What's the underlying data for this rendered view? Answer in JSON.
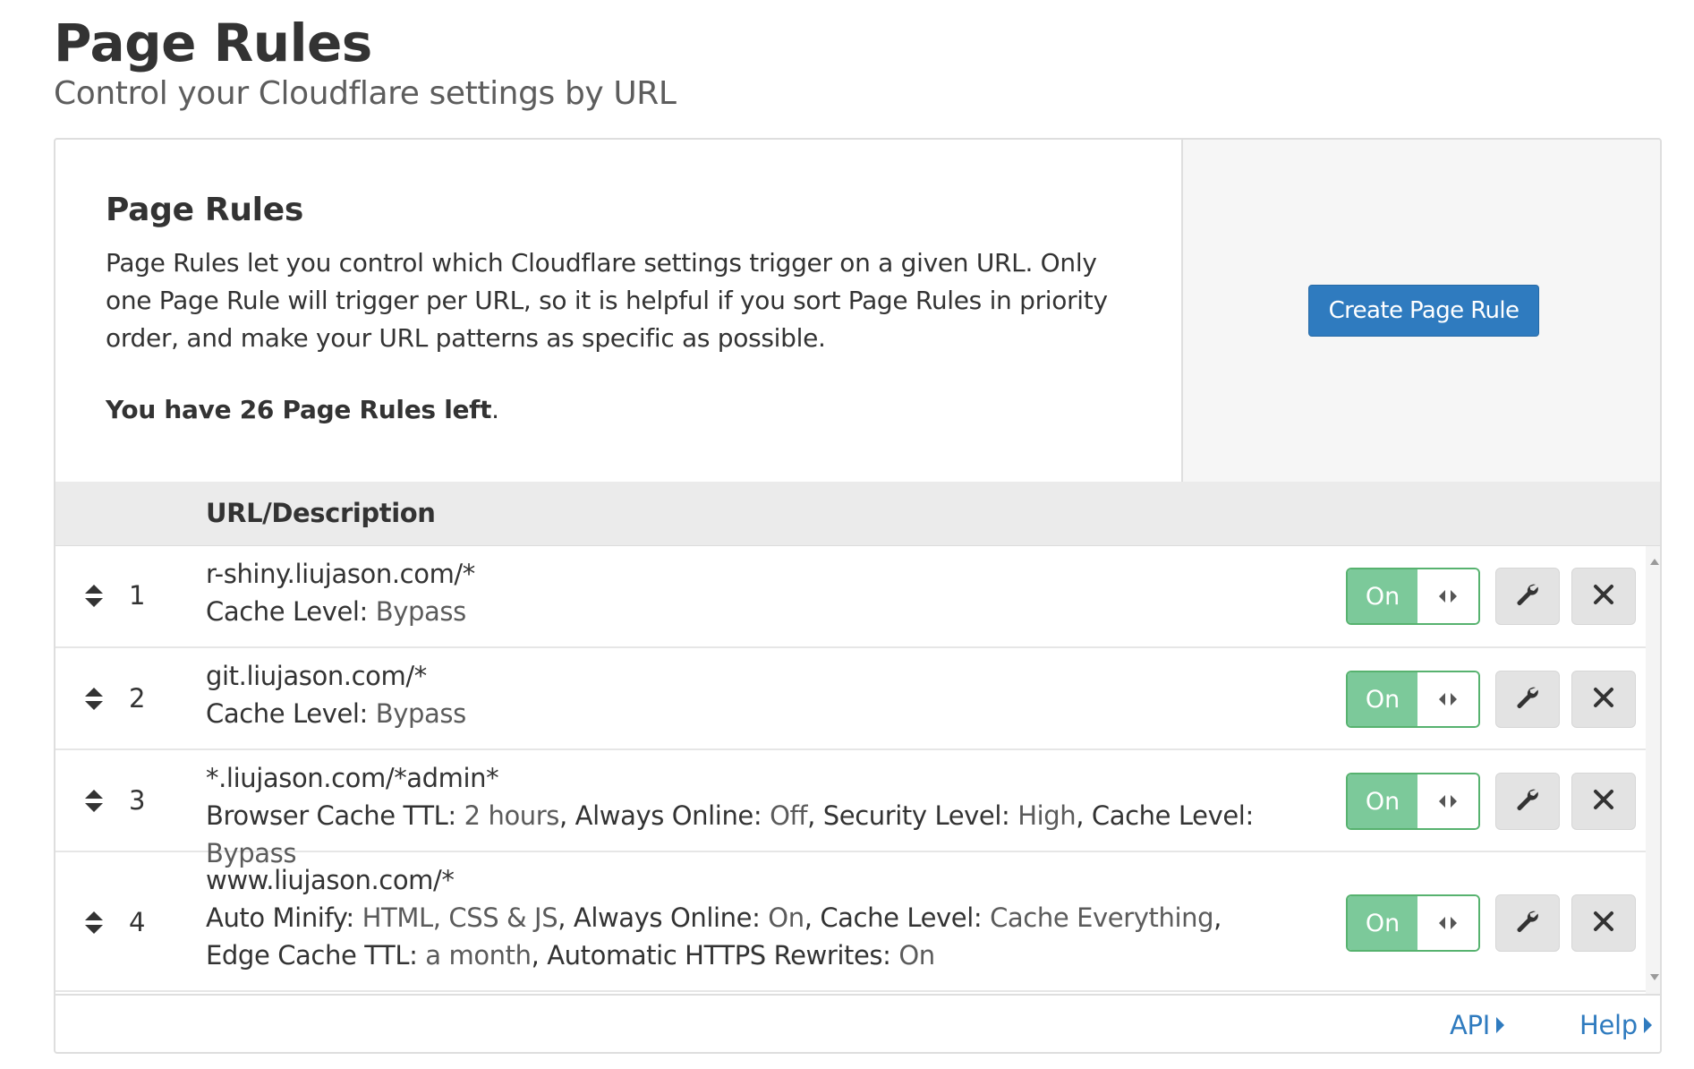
{
  "page": {
    "title": "Page Rules",
    "subtitle": "Control your Cloudflare settings by URL"
  },
  "intro": {
    "title": "Page Rules",
    "description": "Page Rules let you control which Cloudflare settings trigger on a given URL. Only one Page Rule will trigger per URL, so it is helpful if you sort Page Rules in priority order, and make your URL patterns as specific as possible.",
    "remaining_bold": "You have 26 Page Rules left",
    "remaining_tail": ".",
    "create_button": "Create Page Rule"
  },
  "table": {
    "column_header": "URL/Description",
    "rows": [
      {
        "index": "1",
        "url": "r-shiny.liujason.com/*",
        "settings": [
          {
            "key": "Cache Level:",
            "value": "Bypass"
          }
        ],
        "toggle": "On"
      },
      {
        "index": "2",
        "url": "git.liujason.com/*",
        "settings": [
          {
            "key": "Cache Level:",
            "value": "Bypass"
          }
        ],
        "toggle": "On"
      },
      {
        "index": "3",
        "url": "*.liujason.com/*admin*",
        "settings": [
          {
            "key": "Browser Cache TTL:",
            "value": "2 hours"
          },
          {
            "key": "Always Online:",
            "value": "Off"
          },
          {
            "key": "Security Level:",
            "value": "High"
          },
          {
            "key": "Cache Level:",
            "value": "Bypass"
          }
        ],
        "toggle": "On"
      },
      {
        "index": "4",
        "url": "www.liujason.com/*",
        "settings": [
          {
            "key": "Auto Minify:",
            "value": "HTML, CSS & JS"
          },
          {
            "key": "Always Online:",
            "value": "On"
          },
          {
            "key": "Cache Level:",
            "value": "Cache Everything"
          },
          {
            "key": "Edge Cache TTL:",
            "value": "a month"
          },
          {
            "key": "Automatic HTTPS Rewrites:",
            "value": "On"
          }
        ],
        "toggle": "On"
      }
    ]
  },
  "footer": {
    "api_link": "API",
    "help_link": "Help"
  },
  "colors": {
    "accent": "#2f7bbf",
    "toggle_on": "#7cc99a",
    "header_bg": "#ebebeb"
  },
  "icons": [
    "sort-drag-icon",
    "toggle-arrows-icon",
    "wrench-icon",
    "close-icon",
    "caret-right-icon"
  ]
}
